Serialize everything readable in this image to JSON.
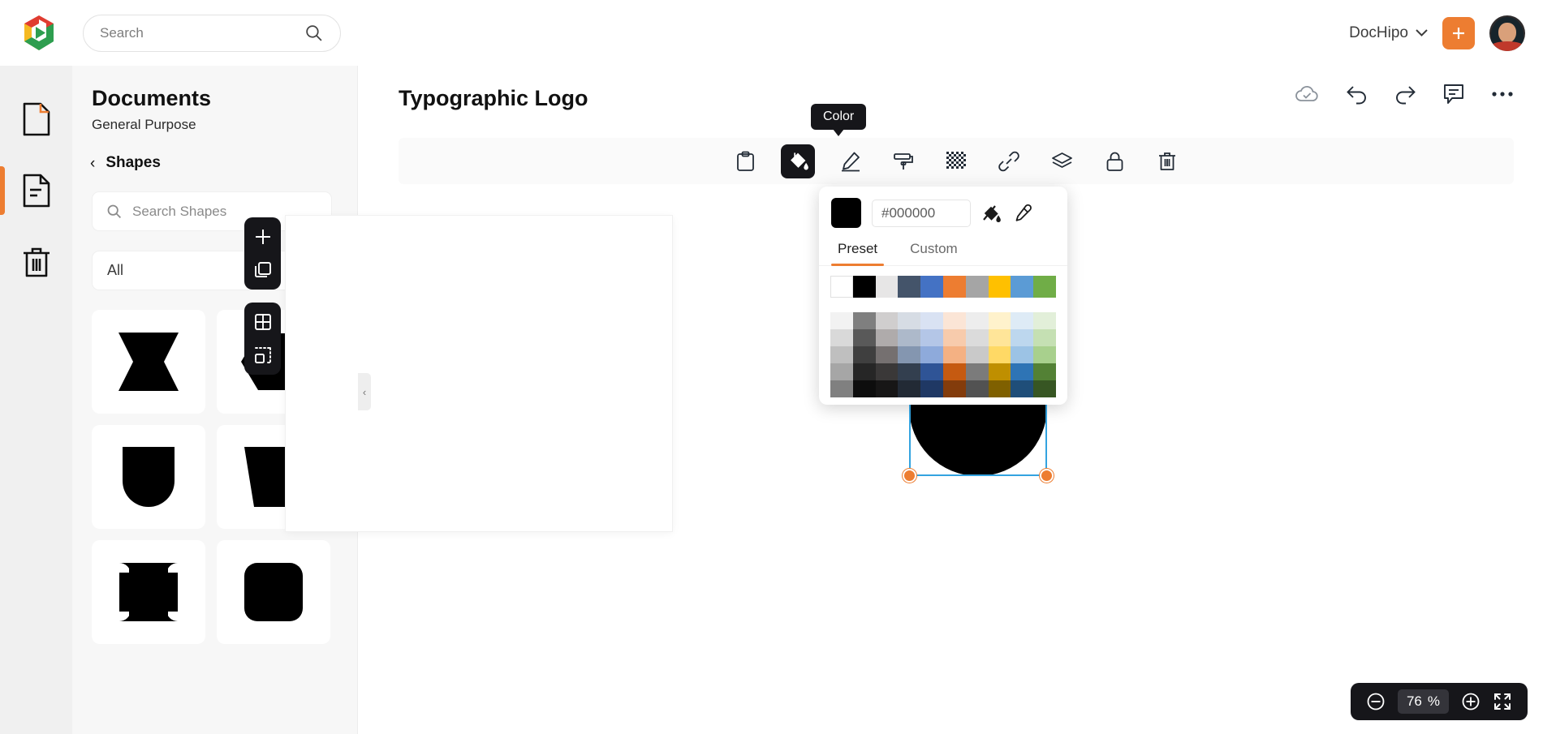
{
  "topbar": {
    "search": {
      "placeholder": "Search",
      "value": ""
    },
    "workspace": "DocHipo",
    "add_label": "+",
    "icons": [
      "brand-logo",
      "search-icon",
      "chevron-down-icon",
      "plus-icon",
      "avatar"
    ]
  },
  "rail": {
    "items": [
      {
        "name": "blank-page",
        "active": false
      },
      {
        "name": "documents",
        "active": true
      },
      {
        "name": "trash",
        "active": false
      }
    ]
  },
  "panel": {
    "title": "Documents",
    "subtitle": "General Purpose",
    "breadcrumb": {
      "back": "‹",
      "label": "Shapes"
    },
    "search": {
      "placeholder": "Search Shapes",
      "value": ""
    },
    "category": {
      "selected": "All"
    },
    "shapes": [
      {
        "name": "bowtie-hourglass-shape"
      },
      {
        "name": "hexagon-shape"
      },
      {
        "name": "u-bullet-shape"
      },
      {
        "name": "trapezoid-cup-shape"
      },
      {
        "name": "concave-corner-square-shape"
      },
      {
        "name": "rounded-chamfer-square-shape"
      }
    ],
    "collapse": "‹"
  },
  "editor": {
    "document_title": "Typographic Logo",
    "actions": [
      {
        "name": "cloud-saved-icon",
        "label": "Saved"
      },
      {
        "name": "undo-icon",
        "label": "Undo"
      },
      {
        "name": "redo-icon",
        "label": "Redo"
      },
      {
        "name": "comment-icon",
        "label": "Comments"
      },
      {
        "name": "more-options-icon",
        "label": "More"
      }
    ],
    "toolbar": {
      "tooltip": "Color",
      "items": [
        {
          "name": "clipboard-icon",
          "label": "Copy Style",
          "active": false
        },
        {
          "name": "paint-bucket-icon",
          "label": "Color",
          "active": true
        },
        {
          "name": "pencil-edit-icon",
          "label": "Border",
          "active": false
        },
        {
          "name": "paint-roller-icon",
          "label": "Effects",
          "active": false
        },
        {
          "name": "transparency-icon",
          "label": "Transparency",
          "active": false
        },
        {
          "name": "link-icon",
          "label": "Link",
          "active": false
        },
        {
          "name": "layers-icon",
          "label": "Position",
          "active": false
        },
        {
          "name": "lock-icon",
          "label": "Lock",
          "active": false
        },
        {
          "name": "trash-icon",
          "label": "Delete",
          "active": false
        }
      ]
    },
    "canvas_tools": [
      {
        "name": "add-page-icon",
        "label": "Add Page"
      },
      {
        "name": "duplicate-page-icon",
        "label": "Duplicate Page"
      },
      {
        "name": "grid-layout-icon",
        "label": "Grid"
      },
      {
        "name": "crop-selection-icon",
        "label": "Selection"
      }
    ],
    "selection": {
      "shape": "u-bullet-shape",
      "fill": "#000000",
      "handles": [
        "bottom-left",
        "bottom-right"
      ]
    }
  },
  "color_picker": {
    "swatch": "#000000",
    "hex_value": "#000000",
    "hex_placeholder": "#000000",
    "no_fill_icon": "no-fill-icon",
    "eyedropper_icon": "eyedropper-icon",
    "tabs": [
      {
        "label": "Preset",
        "active": true
      },
      {
        "label": "Custom",
        "active": false
      }
    ],
    "palette": [
      [
        "#FFFFFF",
        "#000000",
        "#E7E6E6",
        "#44546A",
        "#4472C4",
        "#ED7D31",
        "#A5A5A5",
        "#FFC000",
        "#5B9BD5",
        "#70AD47"
      ],
      [
        "#F2F2F2",
        "#7F7F7F",
        "#D0CECE",
        "#D6DCE4",
        "#D9E2F3",
        "#FBE5D6",
        "#EDEDED",
        "#FFF2CC",
        "#DEEBF6",
        "#E2EFD9"
      ],
      [
        "#D9D9D9",
        "#595959",
        "#AFABAB",
        "#ADB9CA",
        "#B4C6E7",
        "#F7CBAC",
        "#DBDBDB",
        "#FFE599",
        "#BDD7EE",
        "#C5E0B3"
      ],
      [
        "#BFBFBF",
        "#3F3F3F",
        "#757070",
        "#8496B0",
        "#8EAADB",
        "#F4B183",
        "#C9C9C9",
        "#FFD965",
        "#9CC3E5",
        "#A8D08D"
      ],
      [
        "#A6A6A6",
        "#262626",
        "#3A3838",
        "#333F4F",
        "#2F5496",
        "#C55A11",
        "#7B7B7B",
        "#BF8F00",
        "#2E74B5",
        "#538135"
      ],
      [
        "#808080",
        "#0D0D0D",
        "#171616",
        "#222A35",
        "#1F3864",
        "#833C0C",
        "#525252",
        "#7F6000",
        "#1F4E79",
        "#375623"
      ]
    ]
  },
  "zoom": {
    "decrease": "minus-icon",
    "value": "76",
    "unit": "%",
    "increase": "plus-icon",
    "fullscreen": "fullscreen-icon"
  }
}
